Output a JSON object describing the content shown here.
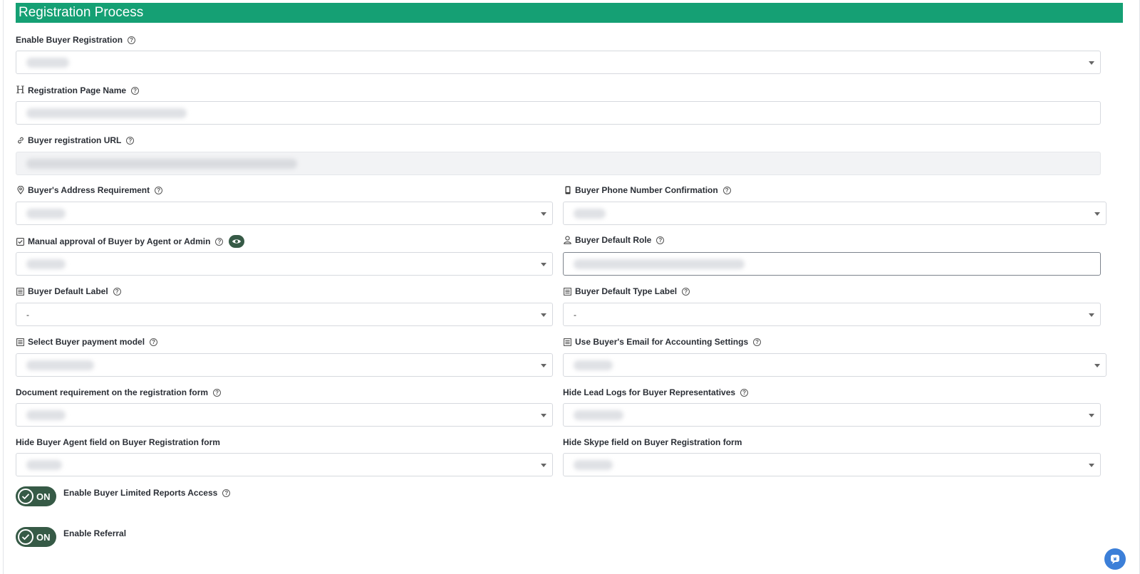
{
  "header": {
    "title": "Registration Process"
  },
  "fields": {
    "enable_buyer_registration": {
      "label": "Enable Buyer Registration"
    },
    "registration_page_name": {
      "label": "Registration Page Name"
    },
    "buyer_registration_url": {
      "label": "Buyer registration URL"
    },
    "buyer_address_requirement": {
      "label": "Buyer's Address Requirement"
    },
    "buyer_phone_confirmation": {
      "label": "Buyer Phone Number Confirmation"
    },
    "manual_approval": {
      "label": "Manual approval of Buyer by Agent or Admin"
    },
    "buyer_default_role": {
      "label": "Buyer Default Role"
    },
    "buyer_default_label": {
      "label": "Buyer Default Label",
      "value": "-"
    },
    "buyer_default_type_label": {
      "label": "Buyer Default Type Label",
      "value": "-"
    },
    "select_buyer_payment_model": {
      "label": "Select Buyer payment model"
    },
    "use_buyer_email_accounting": {
      "label": "Use Buyer's Email for Accounting Settings"
    },
    "document_requirement": {
      "label": "Document requirement on the registration form"
    },
    "hide_lead_logs": {
      "label": "Hide Lead Logs for Buyer Representatives"
    },
    "hide_buyer_agent_field": {
      "label": "Hide Buyer Agent field on Buyer Registration form"
    },
    "hide_skype_field": {
      "label": "Hide Skype field on Buyer Registration form"
    }
  },
  "toggles": {
    "limited_reports": {
      "label": "Enable Buyer Limited Reports Access",
      "state": "ON"
    },
    "referral": {
      "label": "Enable Referral",
      "state": "ON"
    }
  },
  "icons": {
    "help": "question-circle-icon",
    "heading": "heading-icon",
    "link": "link-icon",
    "location": "map-pin-icon",
    "phone": "mobile-phone-icon",
    "checkbox": "checkbox-icon",
    "user": "user-icon",
    "list": "list-icon",
    "eye": "eye-icon",
    "chat": "chat-icon"
  },
  "colors": {
    "header": "#15a074",
    "toggle": "#365a46",
    "chat": "#3c7fd8"
  }
}
